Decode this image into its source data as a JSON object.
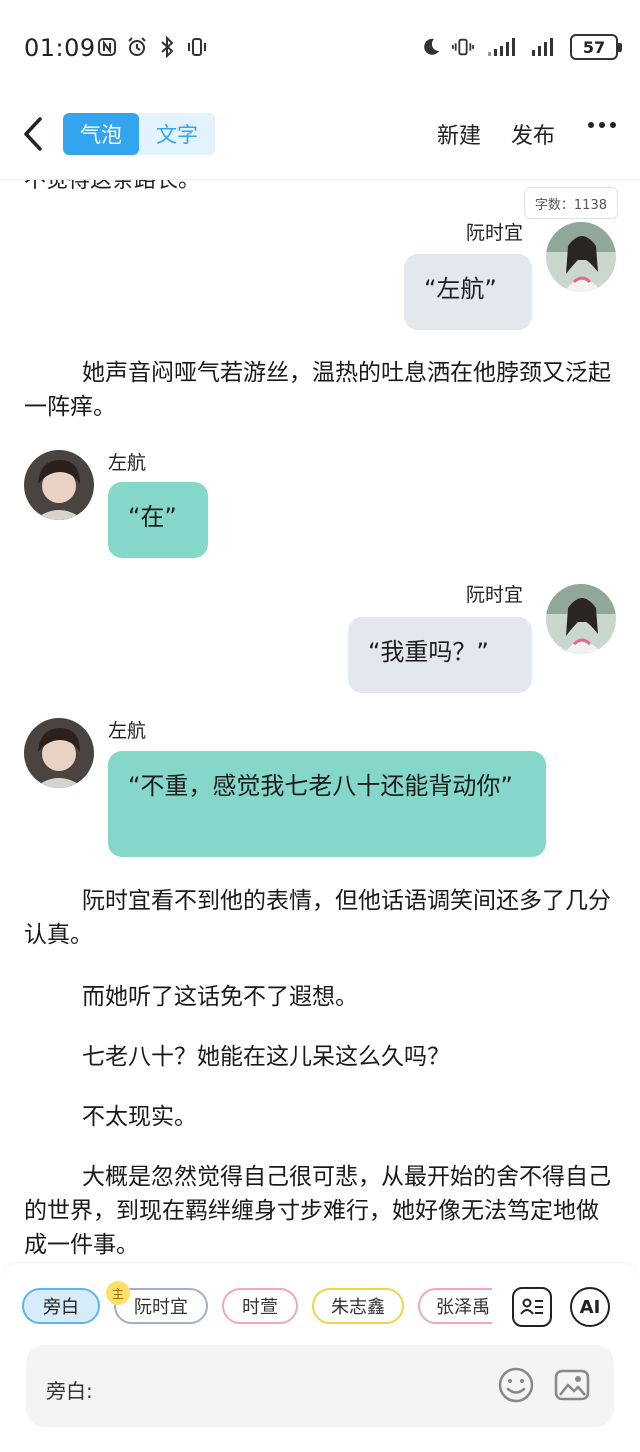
{
  "status_bar": {
    "time": "01:09",
    "left_icons": [
      "nfc-icon",
      "alarm-icon",
      "bluetooth-icon",
      "vibrate-icon"
    ],
    "right_icons": [
      "moon-icon",
      "vibrate-icon",
      "signal-icon",
      "signal-icon"
    ],
    "battery": "57"
  },
  "nav": {
    "tabs": [
      {
        "label": "气泡",
        "active": true
      },
      {
        "label": "文字",
        "active": false
      }
    ],
    "new_label": "新建",
    "publish_label": "发布",
    "accent": "#33a5ee"
  },
  "word_count": "字数：1138",
  "story": {
    "cut_line": "不觉得这条路长。",
    "messages": [
      {
        "kind": "bubble",
        "speaker": "阮时宜",
        "side": "right",
        "text": "“左航”"
      },
      {
        "kind": "para",
        "text": "她声音闷哑气若游丝，温热的吐息洒在他脖颈又泛起一阵痒。"
      },
      {
        "kind": "bubble",
        "speaker": "左航",
        "side": "left",
        "text": "“在”"
      },
      {
        "kind": "bubble",
        "speaker": "阮时宜",
        "side": "right",
        "text": "“我重吗？”"
      },
      {
        "kind": "bubble",
        "speaker": "左航",
        "side": "left",
        "text": "“不重，感觉我七老八十还能背动你”"
      },
      {
        "kind": "para",
        "text": "阮时宜看不到他的表情，但他话语调笑间还多了几分认真。"
      },
      {
        "kind": "para",
        "text": "而她听了这话免不了遐想。"
      },
      {
        "kind": "para",
        "text": "七老八十？她能在这儿呆这么久吗？"
      },
      {
        "kind": "para",
        "text": "不太现实。"
      },
      {
        "kind": "para",
        "text": "大概是忽然觉得自己很可悲，从最开始的舍不得自己的世界，到现在羁绊缠身寸步难行，她好像无法笃定地做成一件事。"
      }
    ],
    "bubble_colors": {
      "right": "#e3e8ef",
      "left": "#85d7c9"
    }
  },
  "toolbar": {
    "roles": [
      {
        "label": "旁白",
        "selected": true,
        "color": "#5ab6f2"
      },
      {
        "label": "阮时宜",
        "selected": false,
        "color": "#9fb0c8",
        "badge": "主"
      },
      {
        "label": "时萱",
        "selected": false,
        "color": "#f2a8b8"
      },
      {
        "label": "朱志鑫",
        "selected": false,
        "color": "#f0d34a"
      },
      {
        "label": "张泽禹",
        "selected": false,
        "color": "#f2a8b8"
      }
    ],
    "ai_label": "AI",
    "input_label": "旁白:"
  }
}
